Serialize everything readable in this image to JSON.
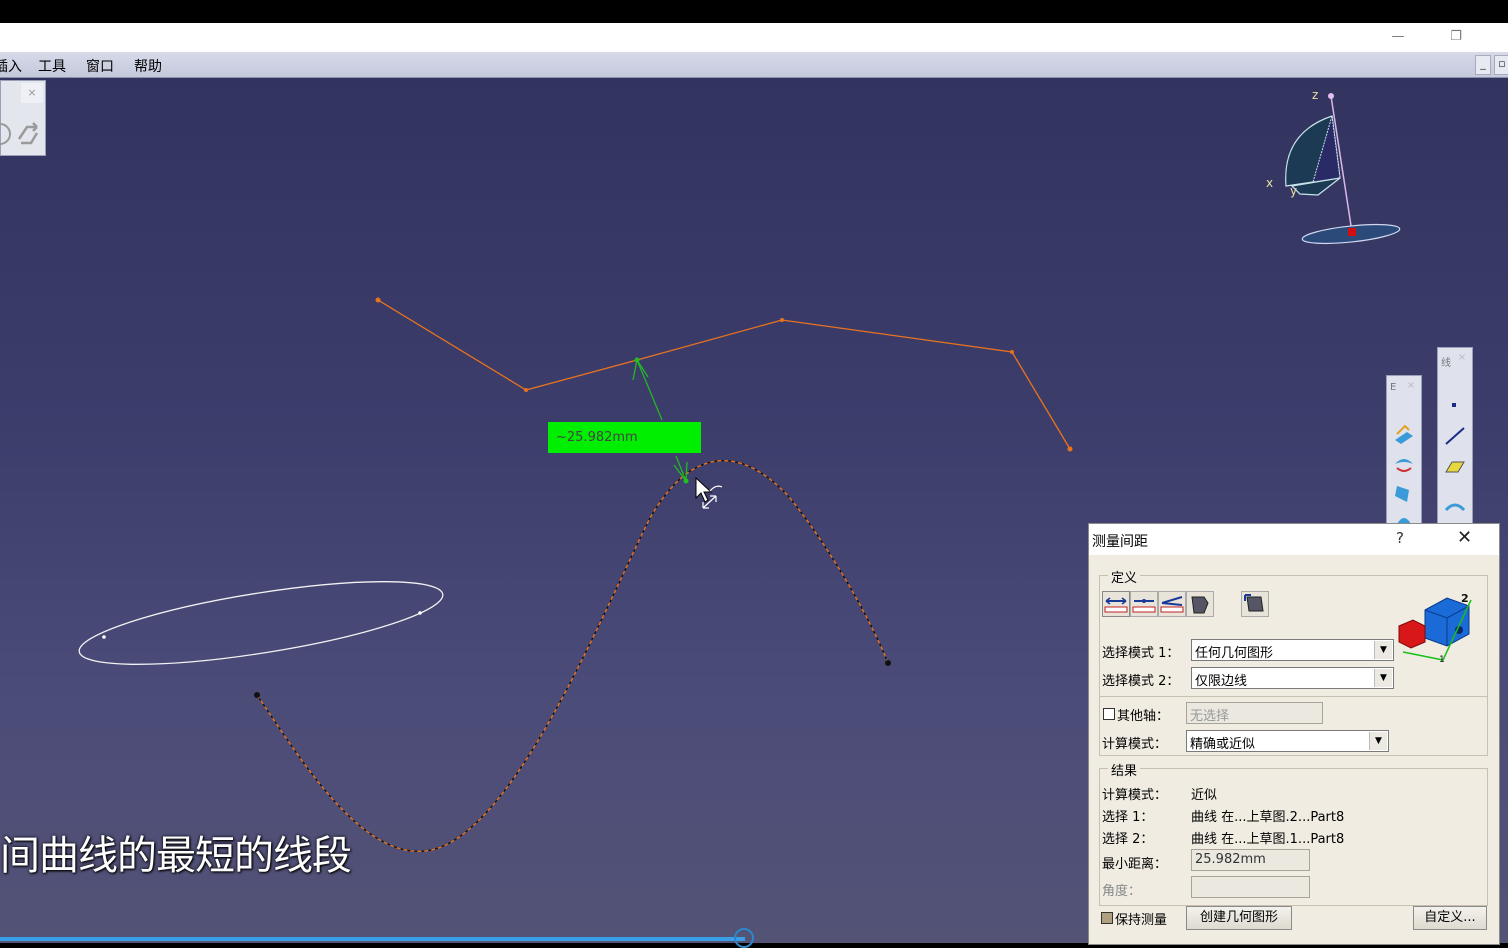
{
  "window": {
    "minimize_glyph": "—",
    "restore_glyph": "❐"
  },
  "menu": {
    "items": [
      "插入",
      "工具",
      "窗口",
      "帮助"
    ]
  },
  "measurement_label": "~25.982mm",
  "subtitle": "间曲线的最短的线段",
  "compass": {
    "x_label": "x",
    "y_label": "y",
    "z_label": "z"
  },
  "dialog": {
    "title": "测量间距",
    "help": "?",
    "close": "✕",
    "definition_group": "定义",
    "select_mode_1_label": "选择模式 1：",
    "select_mode_1_value": "任何几何图形",
    "select_mode_2_label": "选择模式 2：",
    "select_mode_2_value": "仅限边线",
    "other_axis_label": "其他轴：",
    "other_axis_placeholder": "无选择",
    "calc_mode_label": "计算模式：",
    "calc_mode_value": "精确或近似",
    "result_group": "结果",
    "result_calc_mode_label": "计算模式：",
    "result_calc_mode_value": "近似",
    "selection_1_label": "选择 1：",
    "selection_1_value": "曲线 在...上草图.2...Part8",
    "selection_2_label": "选择 2：",
    "selection_2_value": "曲线 在...上草图.1...Part8",
    "min_distance_label": "最小距离：",
    "min_distance_value": "25.982mm",
    "angle_label": "角度：",
    "angle_value": "",
    "keep_measure_label": "保持测量",
    "create_geometry_button": "创建几何图形",
    "customize_button": "自定义..."
  },
  "colors": {
    "viewport": "#3d3d6c",
    "polyline": "#e8731e",
    "measure": "#00ef00",
    "curve": "#e8731e"
  }
}
